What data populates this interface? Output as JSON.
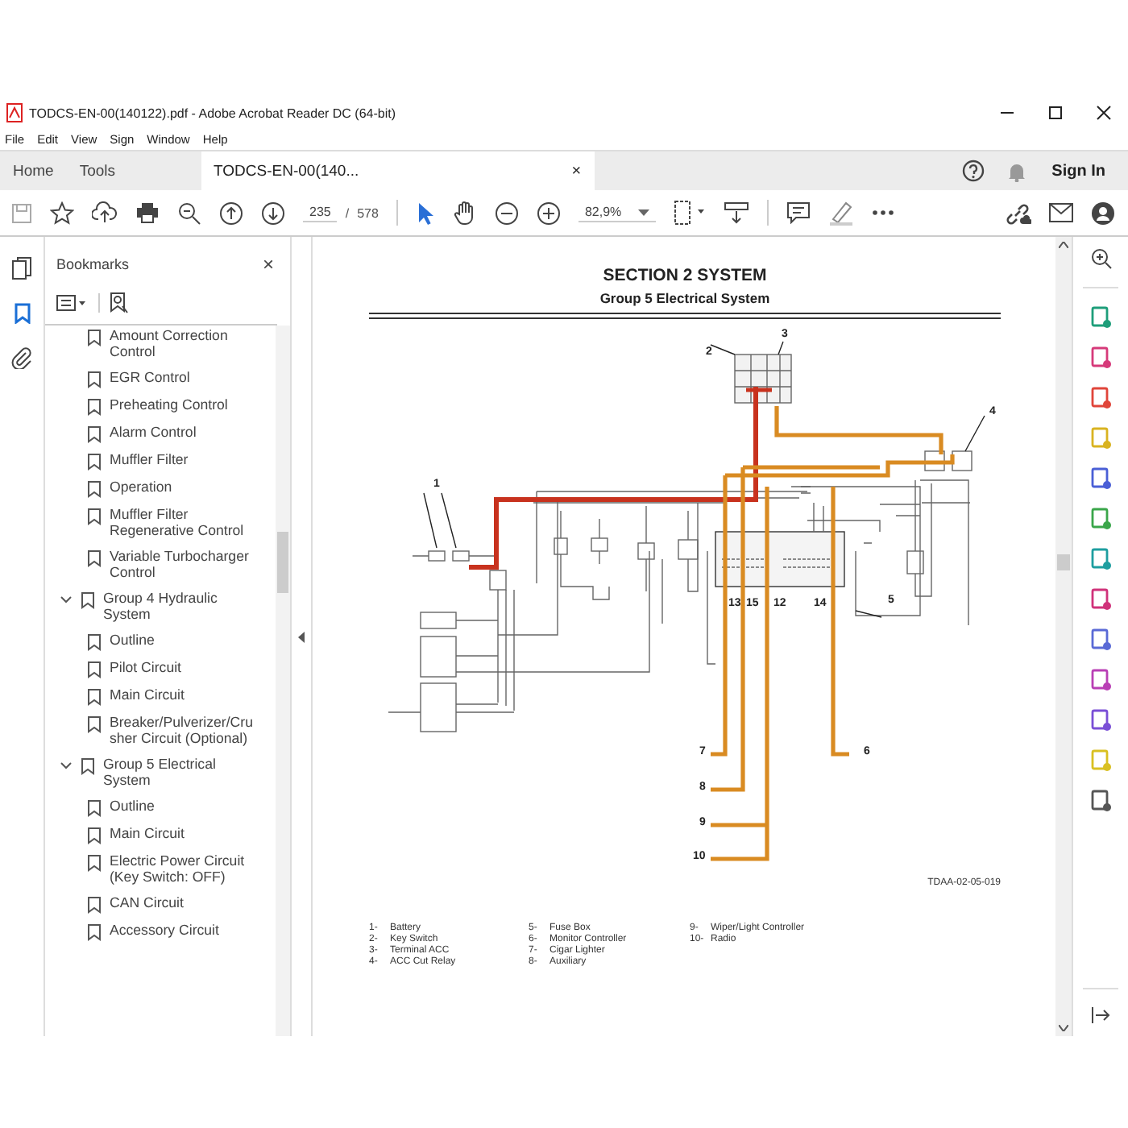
{
  "window": {
    "title": "TODCS-EN-00(140122).pdf - Adobe Acrobat Reader DC (64-bit)"
  },
  "menu": [
    "File",
    "Edit",
    "View",
    "Sign",
    "Window",
    "Help"
  ],
  "tabs": [
    {
      "label": "Home",
      "selected": false,
      "kind": "nav"
    },
    {
      "label": "Tools",
      "selected": false,
      "kind": "nav"
    },
    {
      "label": "TODCS-EN-00(140...",
      "selected": true,
      "kind": "document",
      "close": "×"
    }
  ],
  "sign_in": "Sign In",
  "toolbar": {
    "page": "235",
    "page_sep": "/",
    "page_count": "578",
    "zoom": "82,9%"
  },
  "bookmarks": {
    "title": "Bookmarks",
    "close": "×",
    "loose_items": [
      {
        "label": "Amount Correction Control"
      },
      {
        "label": "EGR Control"
      },
      {
        "label": "Preheating Control"
      },
      {
        "label": "Alarm Control"
      },
      {
        "label": "Muffler Filter"
      },
      {
        "label": "Operation"
      },
      {
        "label": "Muffler Filter Regenerative Control"
      },
      {
        "label": "Variable Turbocharger Control"
      }
    ],
    "groups": [
      {
        "label": "Group 4 Hydraulic System",
        "expanded": true,
        "children": [
          {
            "label": "Outline"
          },
          {
            "label": "Pilot Circuit"
          },
          {
            "label": "Main Circuit"
          },
          {
            "label": "Breaker/Pulverizer/Crusher Circuit (Optional)"
          }
        ]
      },
      {
        "label": "Group 5 Electrical System",
        "expanded": true,
        "children": [
          {
            "label": "Outline"
          },
          {
            "label": "Main Circuit"
          },
          {
            "label": "Electric Power Circuit (Key Switch: OFF)"
          },
          {
            "label": "CAN Circuit"
          },
          {
            "label": "Accessory Circuit"
          }
        ]
      }
    ]
  },
  "page": {
    "section": "SECTION 2 SYSTEM",
    "group": "Group 5 Electrical System",
    "callouts": [
      "1",
      "2",
      "3",
      "4",
      "13",
      "15",
      "12",
      "14",
      "5",
      "7",
      "6",
      "8",
      "9",
      "10"
    ],
    "figure_code": "TDAA-02-05-019",
    "legend": [
      {
        "number": "1-",
        "label": "Battery"
      },
      {
        "number": "2-",
        "label": "Key Switch"
      },
      {
        "number": "3-",
        "label": "Terminal ACC"
      },
      {
        "number": "4-",
        "label": "ACC Cut Relay"
      },
      {
        "number": "5-",
        "label": "Fuse Box"
      },
      {
        "number": "6-",
        "label": "Monitor Controller"
      },
      {
        "number": "7-",
        "label": "Cigar Lighter"
      },
      {
        "number": "8-",
        "label": "Auxiliary"
      },
      {
        "number": "9-",
        "label": "Wiper/Light Controller"
      },
      {
        "number": "10-",
        "label": "Radio"
      }
    ]
  }
}
